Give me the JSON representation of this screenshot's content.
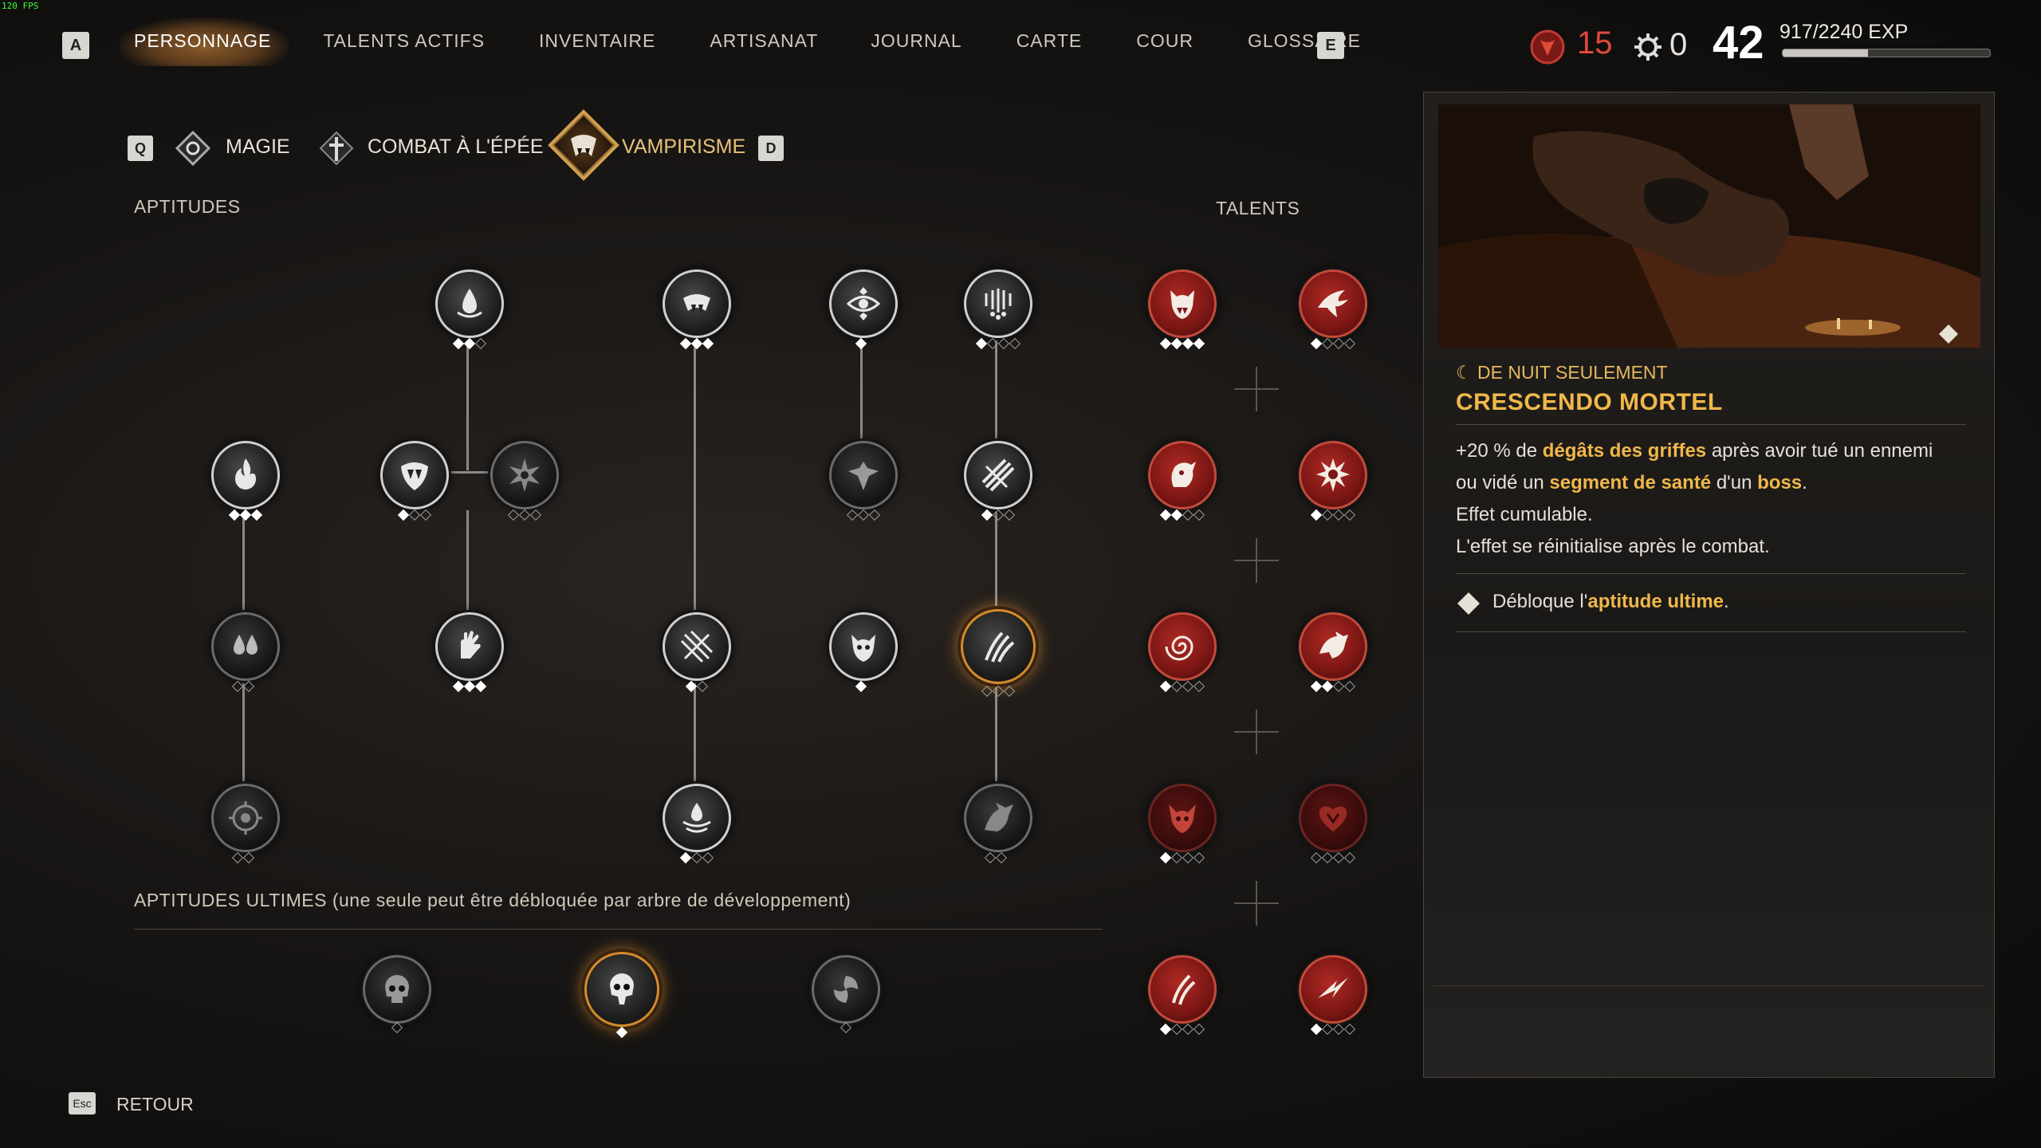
{
  "fps": "120 FPS",
  "top_nav": {
    "left_key": "A",
    "right_key": "E",
    "items": [
      "PERSONNAGE",
      "TALENTS ACTIFS",
      "INVENTAIRE",
      "ARTISANAT",
      "JOURNAL",
      "CARTE",
      "COUR",
      "GLOSSAIRE"
    ],
    "active_index": 0
  },
  "stats": {
    "talent_points": "15",
    "skill_points": "0",
    "level": "42",
    "exp_text": "917/2240 EXP",
    "exp_progress": 0.41
  },
  "tree_tabs": {
    "left_key": "Q",
    "right_key": "D",
    "items": [
      "MAGIE",
      "COMBAT À L'ÉPÉE",
      "VAMPIRISME"
    ],
    "active_index": 2
  },
  "sections": {
    "aptitudes": "APTITUDES",
    "talents": "TALENTS",
    "ultimates": "APTITUDES ULTIMES (une seule peut être débloquée par arbre de développement)"
  },
  "detail": {
    "condition": "DE NUIT SEULEMENT",
    "title": "CRESCENDO MORTEL",
    "desc": {
      "p1": "+20 % de ",
      "h1": "dégâts des griffes",
      "p2": " après avoir tué un ennemi",
      "p3": "ou vidé un ",
      "h2": "segment de santé",
      "p4": " d'un ",
      "h3": "boss",
      "p5": ".",
      "line3": "Effet cumulable.",
      "line4": "L'effet se réinitialise après le combat."
    },
    "unlock": {
      "pre": "Débloque l'",
      "hl": "aptitude ultime",
      "post": "."
    }
  },
  "footer": {
    "key": "Esc",
    "label": "RETOUR"
  },
  "colors": {
    "accent_orange": "#f0b84a",
    "points_red": "#e04a3a",
    "selected_glow": "#d48a2c"
  }
}
